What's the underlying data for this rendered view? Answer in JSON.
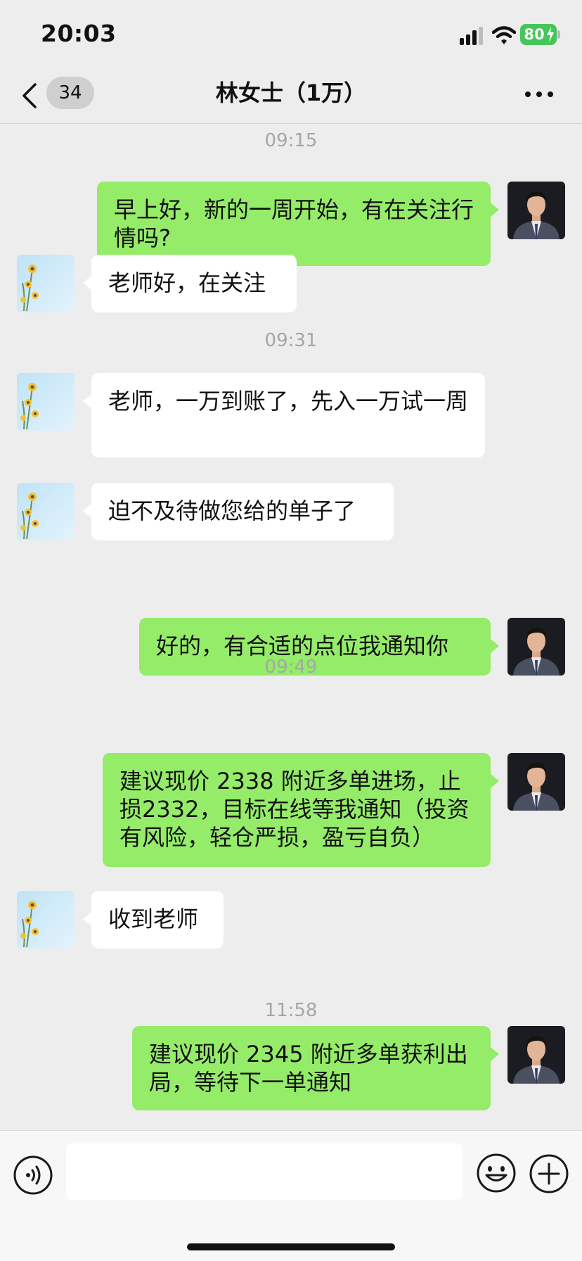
{
  "status_bar": {
    "time": "20:03",
    "battery": "80",
    "icons": [
      "signal-icon",
      "wifi-icon",
      "battery-icon"
    ]
  },
  "nav": {
    "back_icon": "chevron-left-icon",
    "unread_count": "34",
    "title": "林女士（1万）",
    "more_icon": "more-dots-icon"
  },
  "colors": {
    "background": "#ededed",
    "outgoing_bubble": "#95ec69",
    "incoming_bubble": "#ffffff",
    "timestamp": "#a6a6a6",
    "battery": "#45c65a"
  },
  "messages": [
    {
      "type": "timestamp",
      "text": "09:15"
    },
    {
      "type": "out",
      "sender": "teacher-avatar",
      "text": "早上好，新的一周开始，有在关注行情吗?"
    },
    {
      "type": "in",
      "sender": "flower-avatar",
      "text": "老师好，在关注"
    },
    {
      "type": "timestamp",
      "text": "09:31"
    },
    {
      "type": "in",
      "sender": "flower-avatar",
      "text": "老师，一万到账了，先入一万试一周"
    },
    {
      "type": "in",
      "sender": "flower-avatar",
      "text": "迫不及待做您给的单子了"
    },
    {
      "type": "out",
      "sender": "teacher-avatar",
      "text": "好的，有合适的点位我通知你"
    },
    {
      "type": "timestamp",
      "text": "09:49"
    },
    {
      "type": "out",
      "sender": "teacher-avatar",
      "text": "建议现价 2338 附近多单进场，止损2332，目标在线等我通知（投资有风险，轻仓严损，盈亏自负）"
    },
    {
      "type": "in",
      "sender": "flower-avatar",
      "text": "收到老师"
    },
    {
      "type": "timestamp",
      "text": "11:58"
    },
    {
      "type": "out",
      "sender": "teacher-avatar",
      "text": "建议现价 2345 附近多单获利出局，等待下一单通知"
    }
  ],
  "input_bar": {
    "voice_icon": "voice-icon",
    "text_value": "",
    "emoji_icon": "emoji-icon",
    "plus_icon": "plus-icon"
  }
}
